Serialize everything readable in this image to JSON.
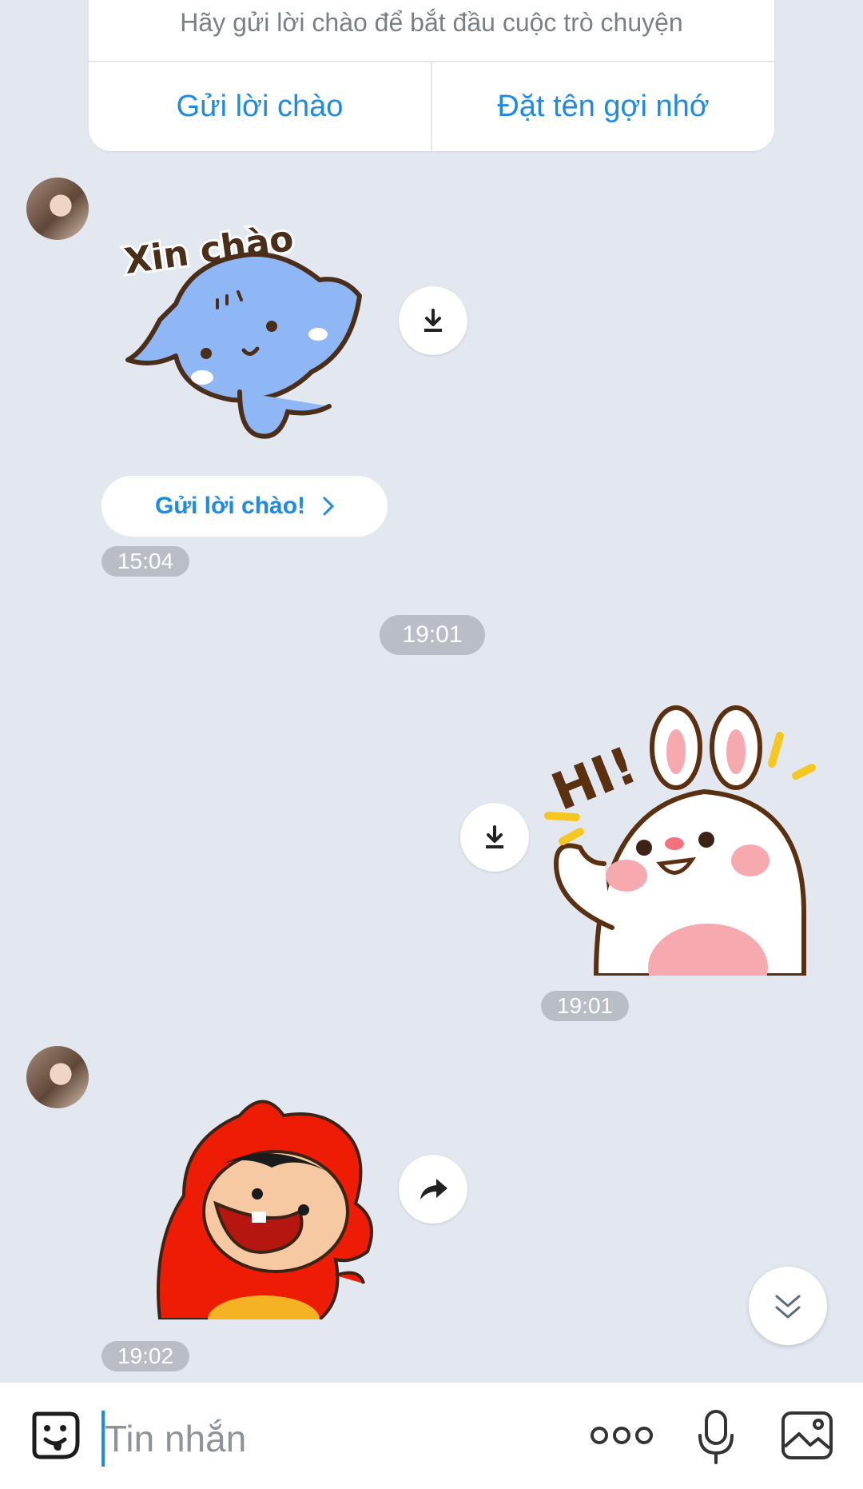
{
  "intro": {
    "subtitle": "Hãy gửi lời chào để bắt đầu cuộc trò chuyện",
    "send_greeting_label": "Gửi lời chào",
    "set_nickname_label": "Đặt tên gợi nhớ"
  },
  "messages": [
    {
      "sender": "contact",
      "sticker": "Xin chào",
      "time": "15:04",
      "action": "download"
    },
    {
      "divider_time": "19:01"
    },
    {
      "sender": "me",
      "sticker": "HI!",
      "time": "19:01",
      "action": "download"
    },
    {
      "sender": "contact",
      "sticker": "red-hooded-girl-laughing",
      "time": "19:02",
      "action": "forward"
    }
  ],
  "greeting_button": {
    "label": "Gửi lời chào!"
  },
  "composer": {
    "placeholder": "Tin nhắn"
  },
  "icons": {
    "emoji": "sticker-emoji-icon",
    "more": "more-dots-icon",
    "mic": "microphone-icon",
    "image": "image-gallery-icon",
    "download": "download-icon",
    "forward": "forward-icon",
    "scroll": "double-chevron-down-icon"
  },
  "colors": {
    "accent": "#1d8be6",
    "background": "#e2e7f0",
    "time_badge": "#b9bec6"
  }
}
